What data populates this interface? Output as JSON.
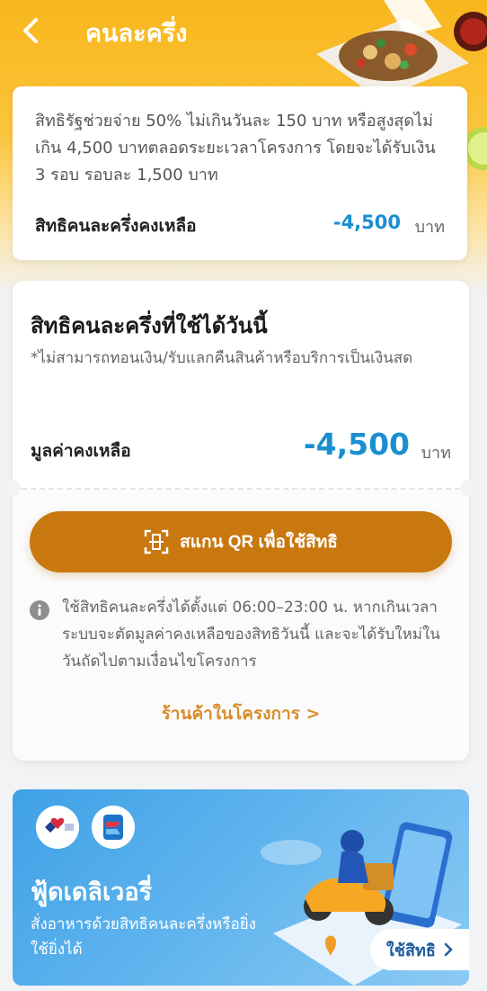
{
  "header": {
    "title": "คนละครึ่ง"
  },
  "summary_card": {
    "description": "สิทธิรัฐช่วยจ่าย 50% ไม่เกินวันละ 150 บาท หรือสูงสุดไม่เกิน 4,500 บาทตลอดระยะเวลาโครงการ โดยจะได้รับเงิน 3 รอบ รอบละ 1,500 บาท",
    "remaining_label": "สิทธิคนละครึ่งคงเหลือ",
    "remaining_value": "-4,500",
    "unit": "บาท"
  },
  "today_card": {
    "title": "สิทธิคนละครึ่งที่ใช้ได้วันนี้",
    "note": "*ไม่สามารถทอนเงิน/รับแลกคืนสินค้าหรือบริการเป็นเงินสด",
    "balance_label": "มูลค่าคงเหลือ",
    "balance_value": "-4,500",
    "unit": "บาท",
    "scan_button": "สแกน QR เพื่อใช้สิทธิ",
    "time_note": "ใช้สิทธิคนละครึ่งได้ตั้งแต่ 06:00–23:00 น. หากเกินเวลา ระบบจะตัดมูลค่าคงเหลือของสิทธิวันนี้ และจะได้รับใหม่ในวันถัดไปตามเงื่อนไขโครงการ",
    "stores_link": "ร้านค้าในโครงการ >"
  },
  "banner": {
    "title": "ฟู้ดเดลิเวอรี่",
    "subtitle": "สั่งอาหารด้วยสิทธิคนละครึ่งหรือยิ่งใช้ยิ่งได้",
    "use_button": "ใช้สิทธิ"
  },
  "colors": {
    "primary_orange": "#c8780e",
    "amount_blue": "#1a8fd0",
    "header_yellow": "#f8b61c",
    "link_orange": "#d88c2a",
    "banner_blue": "#3fa1e6"
  }
}
